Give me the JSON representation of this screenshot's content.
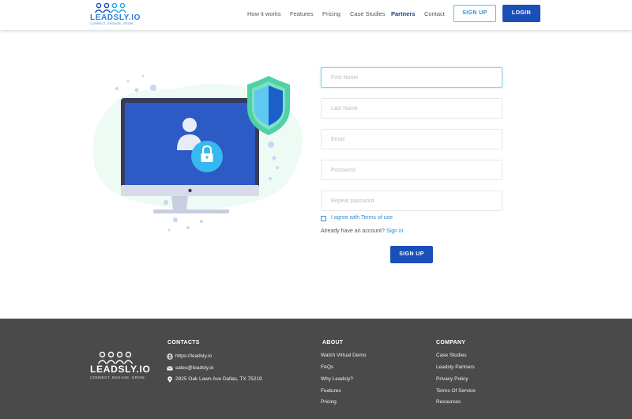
{
  "header": {
    "logo": {
      "brand": "LEADSLY.IO",
      "tagline": "CONNECT. ENGAGE. GROW."
    },
    "nav": [
      "How it works",
      "Features",
      "Pricing",
      "Case Studies",
      "Partners",
      "Contact"
    ],
    "active_nav": "Partners",
    "signup_label": "SIGN UP",
    "login_label": "LOGIN"
  },
  "form": {
    "first_name_placeholder": "First Name",
    "last_name_placeholder": "Last Name",
    "email_placeholder": "Email",
    "password_placeholder": "Password",
    "repeat_password_placeholder": "Repeat password",
    "agree_label": "I agree with Terms of use",
    "have_account": "Already have an account?",
    "signin_label": "Sign in",
    "submit_label": "SIGN UP"
  },
  "footer": {
    "logo": {
      "brand": "LEADSLY.IO",
      "tagline": "CONNECT. ENGAGE. GROW."
    },
    "contacts": {
      "heading": "CONTACTS",
      "website": "https://leadsly.io",
      "email": "sales@leadsly.io",
      "address": "2825 Oak Lawn Ave Dallas, TX 75219"
    },
    "about": {
      "heading": "ABOUT",
      "links": [
        "Watch Virtual Demo",
        "FAQs",
        "Why Leadsly?",
        "Features",
        "Pricing"
      ]
    },
    "company": {
      "heading": "COMPANY",
      "links": [
        "Case Studies",
        "Leadsly Partners",
        "Privacy Policy",
        "Terms Of Service",
        "Resources"
      ]
    }
  },
  "colors": {
    "primary": "#1b4fb8",
    "accent": "#2a8fd0",
    "footer_bg": "#4a4a4a",
    "shield_green": "#4fd1a5"
  }
}
